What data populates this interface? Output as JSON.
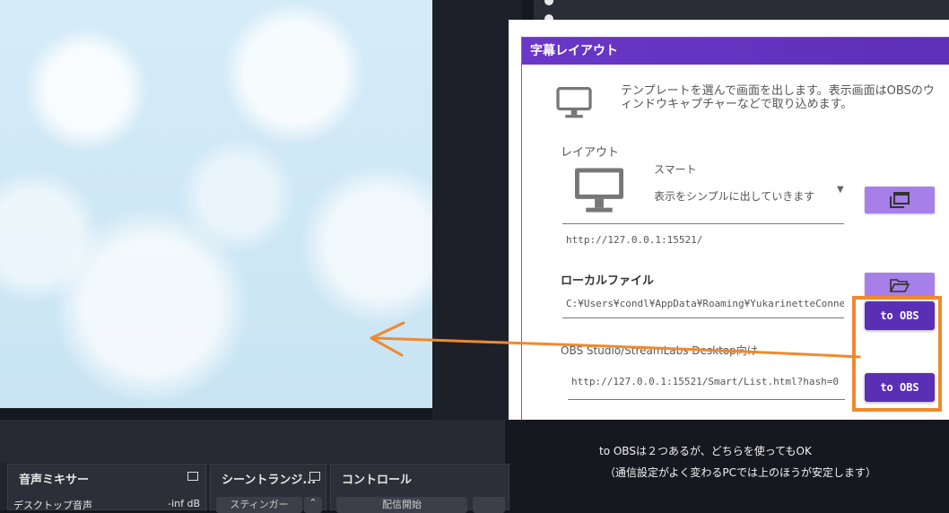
{
  "panel": {
    "title": "字幕レイアウト",
    "description": "テンプレートを選んで画面を出します。表示画面はOBSのウィンドウキャプチャーなどで取り込めます。"
  },
  "layout": {
    "label": "レイアウト",
    "selected_name": "スマート",
    "selected_desc": "表示をシンプルに出していきます",
    "url": "http://127.0.0.1:15521/"
  },
  "local_file": {
    "label": "ローカルファイル",
    "path": "C:¥Users¥condl¥AppData¥Roaming¥YukarinetteConnec"
  },
  "obs_section": {
    "label": "OBS Studio/StreamLabs Desktop向け",
    "url": "http://127.0.0.1:15521/Smart/List.html?hash=0"
  },
  "buttons": {
    "to_obs_1": "to OBS",
    "to_obs_2": "to OBS"
  },
  "annotation": {
    "line1": "to OBSは２つあるが、どちらを使ってもOK",
    "line2": "（通信設定がよく変わるPCでは上のほうが安定します）"
  },
  "obs_docks": {
    "audio_mixer": "音声ミキサー",
    "desktop_audio": "デスクトップ音声",
    "desktop_level": "-inf dB",
    "scene_transition": "シーントランジ...",
    "transition_value": "スティンガー",
    "controls": "コントロール",
    "start_stream": "配信開始"
  },
  "colors": {
    "accent": "#5a2fb6",
    "header": "#6a37c8",
    "highlight": "#f0892e"
  }
}
